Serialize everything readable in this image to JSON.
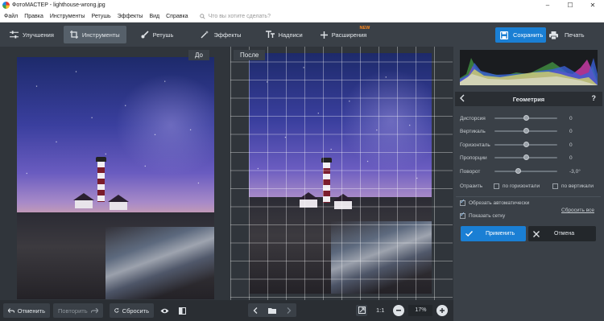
{
  "window": {
    "title": "ФотоМАСТЕР - lighthouse-wrong.jpg",
    "minimize": "–",
    "maximize": "☐",
    "close": "✕"
  },
  "menu": {
    "items": [
      "Файл",
      "Правка",
      "Инструменты",
      "Ретушь",
      "Эффекты",
      "Вид",
      "Справка"
    ],
    "search_placeholder": "Что вы хотите сделать?"
  },
  "toolbar": {
    "tabs": [
      {
        "label": "Улучшения",
        "icon": "sliders-icon",
        "active": false
      },
      {
        "label": "Инструменты",
        "icon": "crop-icon",
        "active": true
      },
      {
        "label": "Ретушь",
        "icon": "brush-icon",
        "active": false
      },
      {
        "label": "Эффекты",
        "icon": "magic-wand-icon",
        "active": false
      },
      {
        "label": "Надписи",
        "icon": "text-icon",
        "active": false
      },
      {
        "label": "Расширения",
        "icon": "plus-icon",
        "active": false,
        "badge": "NEW"
      }
    ],
    "save_label": "Сохранить",
    "print_label": "Печать"
  },
  "canvas": {
    "before_label": "До",
    "after_label": "После"
  },
  "bottombar": {
    "undo_label": "Отменить",
    "redo_label": "Повторить",
    "reset_label": "Сбросить",
    "ratio_label": "1:1",
    "zoom_value": "17%"
  },
  "panel": {
    "title": "Геометрия",
    "help": "?",
    "sliders": [
      {
        "label": "Дисторсия",
        "value": "0",
        "position": 0.5
      },
      {
        "label": "Вертикаль",
        "value": "0",
        "position": 0.5
      },
      {
        "label": "Горизонталь",
        "value": "0",
        "position": 0.5
      },
      {
        "label": "Пропорции",
        "value": "0",
        "position": 0.5
      },
      {
        "label": "Поворот",
        "value": "-3,0°",
        "position": 0.38
      }
    ],
    "align_label": "Отразить",
    "align_horizontal": "по горизонтали",
    "align_vertical": "по вертикали",
    "auto_crop_label": "Обрезать автоматически",
    "show_grid_label": "Показать сетку",
    "reset_all_label": "Сбросить все",
    "apply_label": "Применить",
    "cancel_label": "Отмена"
  },
  "colors": {
    "accent": "#1a7fd4",
    "new_badge": "#ff8a1e",
    "toolbar_bg": "#3a4047",
    "canvas_bg": "#30353b"
  }
}
